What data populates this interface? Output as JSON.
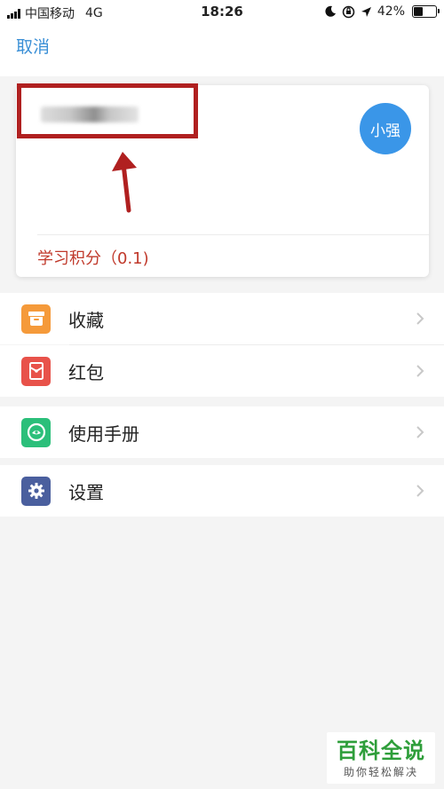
{
  "status_bar": {
    "carrier": "中国移动",
    "network": "4G",
    "time": "18:26",
    "battery": "42%"
  },
  "header": {
    "cancel_label": "取消"
  },
  "profile": {
    "avatar_text": "小强",
    "points_text": "学习积分（0.1)",
    "annotation_color": "#b02020"
  },
  "menu": [
    {
      "label": "收藏",
      "icon": "archive-icon",
      "color": "#f59a3a"
    },
    {
      "label": "红包",
      "icon": "red-envelope-icon",
      "color": "#e8524a"
    },
    {
      "label": "使用手册",
      "icon": "manual-icon",
      "color": "#2bbf7a"
    },
    {
      "label": "设置",
      "icon": "gear-icon",
      "color": "#4a5f9e"
    }
  ],
  "watermark": {
    "title": "百科全说",
    "subtitle": "助你轻松解决"
  }
}
